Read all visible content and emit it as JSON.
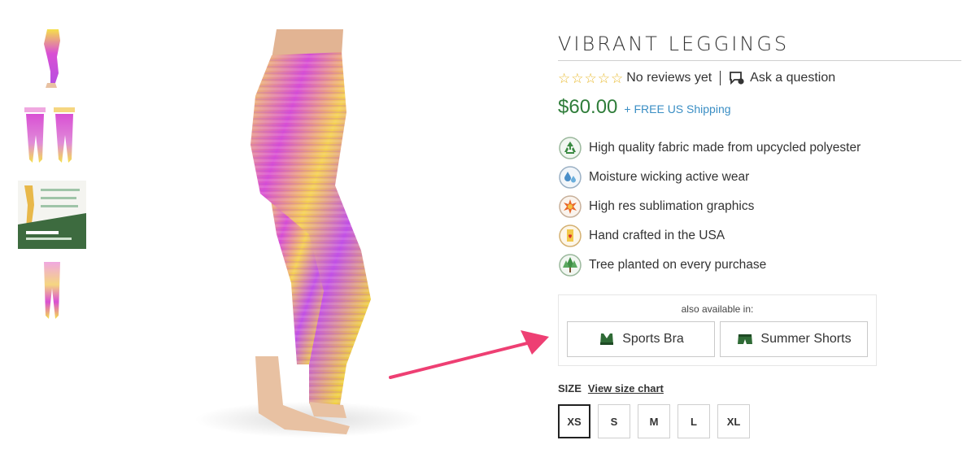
{
  "product": {
    "title": "VIBRANT LEGGINGS",
    "reviews_text": "No reviews yet",
    "ask_question": "Ask a question",
    "price": "$60.00",
    "shipping": "+ FREE US Shipping",
    "rating": 0,
    "rating_max": 5
  },
  "features": [
    {
      "text": "High quality fabric made from upcycled polyester",
      "icon": "recycle-icon"
    },
    {
      "text": "Moisture wicking active wear",
      "icon": "water-drops-icon"
    },
    {
      "text": "High res sublimation graphics",
      "icon": "burst-icon"
    },
    {
      "text": "Hand crafted in the USA",
      "icon": "heart-hand-icon"
    },
    {
      "text": "Tree planted on every purchase",
      "icon": "tree-icon"
    }
  ],
  "also_available": {
    "label": "also available in:",
    "items": [
      {
        "label": "Sports Bra",
        "icon": "sports-bra-icon"
      },
      {
        "label": "Summer Shorts",
        "icon": "shorts-icon"
      }
    ]
  },
  "size": {
    "label": "SIZE",
    "chart_link": "View size chart",
    "options": [
      "XS",
      "S",
      "M",
      "L",
      "XL"
    ],
    "selected": "XS"
  },
  "colors": {
    "price": "#2f7d3a",
    "shipping": "#3a8ec4",
    "star": "#e8b82a",
    "arrow": "#ee3f73",
    "legging_pink": "#d94fd4",
    "legging_yellow": "#f5e04a"
  },
  "thumbnails": [
    {
      "icon": "legging-side-thumb"
    },
    {
      "icon": "legging-front-back-thumb"
    },
    {
      "icon": "tree-tribe-info-thumb"
    },
    {
      "icon": "legging-front-thumb"
    }
  ]
}
